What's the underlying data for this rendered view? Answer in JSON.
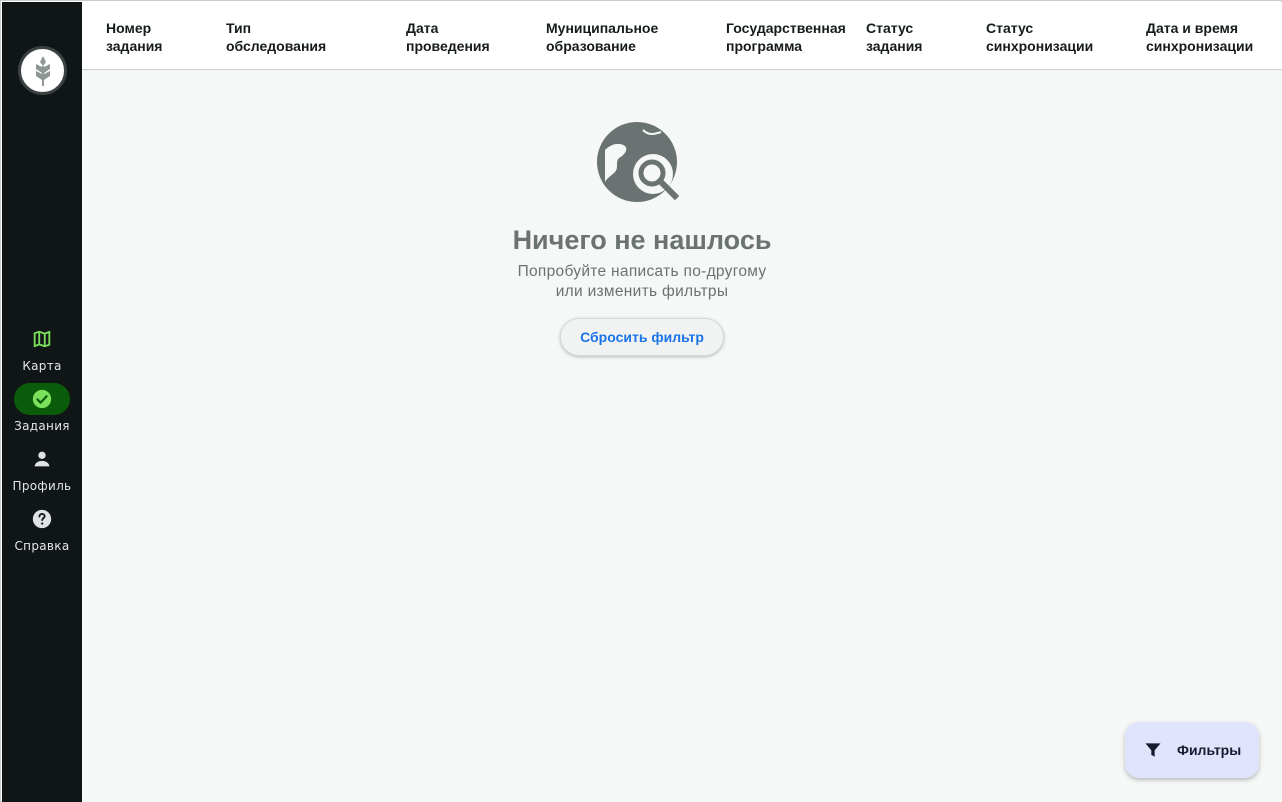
{
  "sidebar": {
    "logo_icon": "wheat-icon",
    "items": [
      {
        "label": "Карта",
        "icon": "map-icon",
        "active": false
      },
      {
        "label": "Задания",
        "icon": "check-circle-icon",
        "active": true
      },
      {
        "label": "Профиль",
        "icon": "person-icon",
        "active": false
      },
      {
        "label": "Справка",
        "icon": "help-circle-icon",
        "active": false
      }
    ]
  },
  "table": {
    "columns": [
      "Номер\nзадания",
      "Тип\nобследования",
      "Дата\nпроведения",
      "Муниципальное\nобразование",
      "Государственная\nпрограмма",
      "Статус\nзадания",
      "Статус\nсинхронизации",
      "Дата и время\nсинхронизации"
    ]
  },
  "empty_state": {
    "icon": "globe-search-icon",
    "title": "Ничего не нашлось",
    "subtitle_line1": "Попробуйте написать по-другому",
    "subtitle_line2": "или изменить фильтры",
    "reset_label": "Сбросить фильтр"
  },
  "filters_fab": {
    "label": "Фильтры",
    "icon": "filter-icon"
  },
  "colors": {
    "sidebar_bg": "#101516",
    "active_pill": "#0a5c0a",
    "accent_green": "#7be05c",
    "link_blue": "#1a73e8",
    "fab_bg": "#dfe3fb"
  }
}
